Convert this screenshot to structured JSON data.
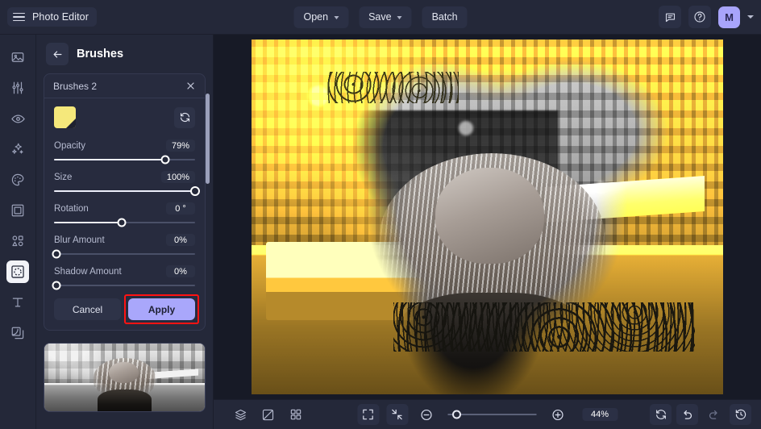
{
  "app": {
    "brand_label": "Photo Editor",
    "menu_icon": "hamburger-icon"
  },
  "topbar": {
    "open_label": "Open",
    "save_label": "Save",
    "batch_label": "Batch",
    "feedback_icon": "comment-icon",
    "help_icon": "help-circle-icon",
    "avatar_initial": "M",
    "avatar_color": "#a8a4fb"
  },
  "rail": {
    "items": [
      {
        "name": "sidebar-item-image",
        "icon": "image-icon",
        "active": false
      },
      {
        "name": "sidebar-item-adjust",
        "icon": "sliders-icon",
        "active": false
      },
      {
        "name": "sidebar-item-retouch",
        "icon": "eye-icon",
        "active": false
      },
      {
        "name": "sidebar-item-effects",
        "icon": "sparkles-icon",
        "active": false
      },
      {
        "name": "sidebar-item-paint",
        "icon": "palette-icon",
        "active": false
      },
      {
        "name": "sidebar-item-frames",
        "icon": "frame-icon",
        "active": false
      },
      {
        "name": "sidebar-item-shapes",
        "icon": "shapes-icon",
        "active": false
      },
      {
        "name": "sidebar-item-brushes",
        "icon": "brush-mask-icon",
        "active": true
      },
      {
        "name": "sidebar-item-text",
        "icon": "text-icon",
        "active": false
      },
      {
        "name": "sidebar-item-layers",
        "icon": "layers-overlay-icon",
        "active": false
      }
    ]
  },
  "panel": {
    "back_icon": "arrow-left-icon",
    "title": "Brushes",
    "card": {
      "title": "Brushes 2",
      "close_icon": "close-icon",
      "color_swatch": "#f5e87b",
      "refresh_icon": "refresh-icon",
      "sliders": [
        {
          "label": "Opacity",
          "value": "79%",
          "pct": 79
        },
        {
          "label": "Size",
          "value": "100%",
          "pct": 100
        },
        {
          "label": "Rotation",
          "value": "0 °",
          "pct": 48
        },
        {
          "label": "Blur Amount",
          "value": "0%",
          "pct": 0
        },
        {
          "label": "Shadow Amount",
          "value": "0%",
          "pct": 0
        }
      ],
      "cancel_label": "Cancel",
      "apply_label": "Apply",
      "highlight_color": "#ff1313"
    }
  },
  "canvas": {
    "tint_color": "#eae47e",
    "description": "black and white street portrait with yellow tint and brush-revealed mask"
  },
  "bottombar": {
    "layers_icon": "layers-icon",
    "compare_icon": "compare-split-icon",
    "grid_icon": "grid-icon",
    "fit_icon": "fit-screen-icon",
    "shrink_icon": "collapse-arrows-icon",
    "zoom_out_icon": "minus-circle-icon",
    "zoom_in_icon": "plus-circle-icon",
    "zoom_value": "44%",
    "zoom_slider_pct": 10,
    "reset_icon": "reset-rotate-icon",
    "undo_icon": "undo-icon",
    "redo_icon": "redo-icon",
    "history_icon": "history-clock-icon"
  }
}
